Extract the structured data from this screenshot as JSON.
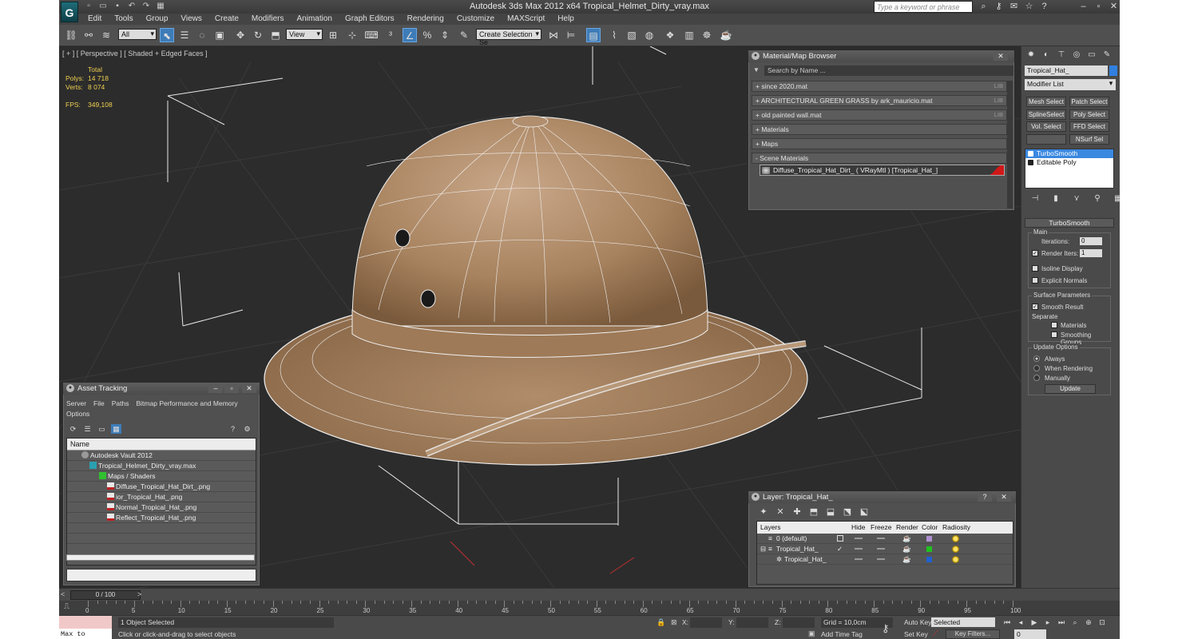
{
  "window": {
    "title": "Autodesk 3ds Max  2012 x64      Tropical_Helmet_Dirty_vray.max",
    "search_placeholder": "Type a keyword or phrase",
    "logo": "G"
  },
  "menu": [
    "Edit",
    "Tools",
    "Group",
    "Views",
    "Create",
    "Modifiers",
    "Animation",
    "Graph Editors",
    "Rendering",
    "Customize",
    "MAXScript",
    "Help"
  ],
  "toolbar": {
    "filter": "All",
    "refcoord": "View",
    "selection_set": "Create Selection Se"
  },
  "viewport": {
    "label": "[ + ] [ Perspective ] [ Shaded + Edged Faces ]",
    "stats": {
      "total_label": "Total",
      "polys_label": "Polys:",
      "polys": "14 718",
      "verts_label": "Verts:",
      "verts": "8 074",
      "fps_label": "FPS:",
      "fps": "349,108"
    }
  },
  "material_browser": {
    "title": "Material/Map Browser",
    "search": "Search by Name ...",
    "rows": [
      {
        "label": "+ since 2020.mat",
        "tag": "LIB"
      },
      {
        "label": "+ ARCHITECTURAL GREEN GRASS by ark_mauricio.mat",
        "tag": "LIB"
      },
      {
        "label": "+ old painted wall.mat",
        "tag": "LIB"
      },
      {
        "label": "+ Materials",
        "tag": ""
      },
      {
        "label": "+ Maps",
        "tag": ""
      },
      {
        "label": "- Scene Materials",
        "tag": ""
      }
    ],
    "scene_material": "Diffuse_Tropical_Hat_Dirt_  ( VRayMtl )  [Tropical_Hat_]"
  },
  "command_panel": {
    "object_name": "Tropical_Hat_",
    "modifier_list": "Modifier List",
    "buttons": [
      "Mesh Select",
      "Patch Select",
      "SplineSelect",
      "Poly Select",
      "Vol. Select",
      "FFD Select",
      "",
      "NSurf Sel"
    ],
    "stack": [
      "TurboSmooth",
      "Editable Poly"
    ],
    "turbosmooth": {
      "title": "TurboSmooth",
      "main": "Main",
      "iterations_label": "Iterations:",
      "iterations": "0",
      "render_iters_label": "Render Iters:",
      "render_iters": "1",
      "isoline": "Isoline Display",
      "explicit": "Explicit Normals",
      "surface": "Surface Parameters",
      "smooth_result": "Smooth Result",
      "separate": "Separate",
      "materials": "Materials",
      "smoothing_groups": "Smoothing Groups",
      "update_options": "Update Options",
      "always": "Always",
      "when_rendering": "When Rendering",
      "manually": "Manually",
      "update": "Update"
    }
  },
  "asset_tracking": {
    "title": "Asset Tracking",
    "menu": [
      "Server",
      "File",
      "Paths",
      "Bitmap Performance and Memory"
    ],
    "menu2": "Options",
    "column": "Name",
    "rows": [
      {
        "label": "Autodesk Vault 2012",
        "indent": 18
      },
      {
        "label": "Tropical_Helmet_Dirty_vray.max",
        "indent": 28
      },
      {
        "label": "Maps / Shaders",
        "indent": 40
      },
      {
        "label": "Diffuse_Tropical_Hat_Dirt_.png",
        "indent": 50
      },
      {
        "label": "ior_Tropical_Hat_.png",
        "indent": 50
      },
      {
        "label": "Normal_Tropical_Hat_.png",
        "indent": 50
      },
      {
        "label": "Reflect_Tropical_Hat_.png",
        "indent": 50
      }
    ]
  },
  "layer": {
    "title": "Layer: Tropical_Hat_",
    "columns": [
      "Layers",
      "Hide",
      "Freeze",
      "Render",
      "Color",
      "Radiosity"
    ],
    "rows": [
      {
        "label": "0 (default)",
        "color": "#b090d0"
      },
      {
        "label": "Tropical_Hat_",
        "color": "#20c020"
      },
      {
        "label": "Tropical_Hat_",
        "color": "#2060d0"
      }
    ]
  },
  "timeline": {
    "slider": "0 / 100",
    "ticks": [
      "0",
      "5",
      "10",
      "15",
      "20",
      "25",
      "30",
      "35",
      "40",
      "45",
      "50",
      "55",
      "60",
      "65",
      "70",
      "75",
      "80",
      "85",
      "90",
      "95",
      "100"
    ]
  },
  "status": {
    "maxscript": "Max to Physc:",
    "selected": "1 Object Selected",
    "prompt": "Click or click-and-drag to select objects",
    "x": "X:",
    "y": "Y:",
    "z": "Z:",
    "grid": "Grid = 10,0cm",
    "add_time_tag": "Add Time Tag",
    "auto_key": "Auto Key",
    "set_key": "Set Key",
    "selected_drop": "Selected",
    "key_filters": "Key Filters...",
    "frame": "0"
  }
}
